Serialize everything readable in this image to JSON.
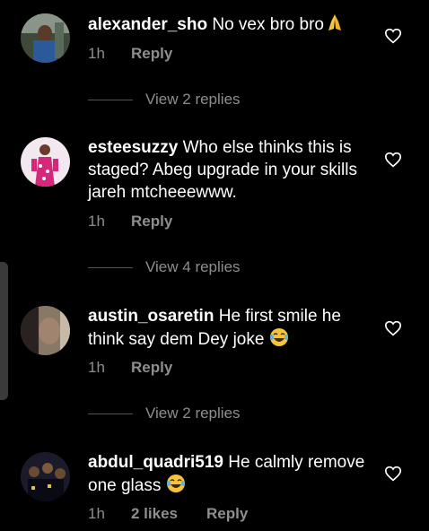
{
  "colors": {
    "background": "#000000",
    "text": "#ffffff",
    "secondary_text": "#8e8e8e"
  },
  "comments": [
    {
      "username": "alexander_sho",
      "text": "No vex bro bro",
      "emoji": "folded-hands-emoji",
      "time": "1h",
      "likes": "",
      "reply_label": "Reply",
      "view_replies": "View 2 replies"
    },
    {
      "username": "esteesuzzy",
      "text": "Who else thinks this is staged? Abeg upgrade in your skills jareh mtcheeewww.",
      "emoji": "",
      "time": "1h",
      "likes": "",
      "reply_label": "Reply",
      "view_replies": "View 4 replies"
    },
    {
      "username": "austin_osaretin",
      "text": "He first smile he think say dem Dey joke",
      "emoji": "tears-of-joy-emoji",
      "time": "1h",
      "likes": "",
      "reply_label": "Reply",
      "view_replies": "View 2 replies"
    },
    {
      "username": "abdul_quadri519",
      "text": "He calmly remove one glass",
      "emoji": "tears-of-joy-emoji",
      "time": "1h",
      "likes": "2 likes",
      "reply_label": "Reply",
      "view_replies": ""
    }
  ]
}
